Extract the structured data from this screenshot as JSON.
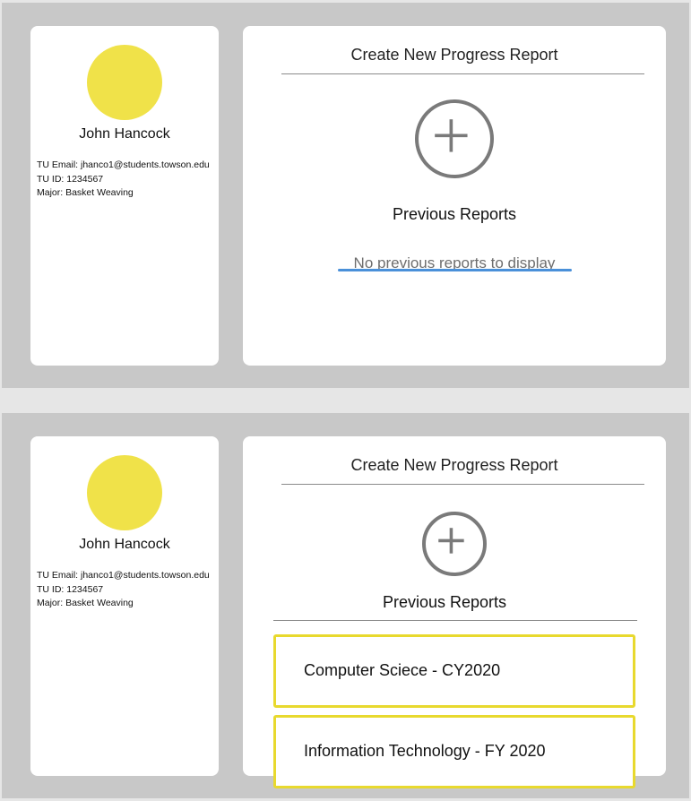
{
  "colors": {
    "avatar": "#f0e249",
    "report_border": "#e8d92e",
    "empty_underline": "#4a90d9",
    "background": "#c8c8c8"
  },
  "screen_empty": {
    "profile": {
      "name": "John Hancock",
      "email": "TU Email: jhanco1@students.towson.edu",
      "tu_id": "TU ID: 1234567",
      "major": "Major: Basket Weaving"
    },
    "main": {
      "create_title": "Create New Progress Report",
      "add_icon": "plus-circle-icon",
      "previous_title": "Previous Reports",
      "empty_message": "No previous reports to display"
    }
  },
  "screen_list": {
    "profile": {
      "name": "John Hancock",
      "email": "TU Email: jhanco1@students.towson.edu",
      "tu_id": "TU ID: 1234567",
      "major": "Major: Basket Weaving"
    },
    "main": {
      "create_title": "Create New Progress Report",
      "add_icon": "plus-circle-icon",
      "previous_title": "Previous Reports",
      "reports": [
        {
          "label": "Computer Sciece - CY2020"
        },
        {
          "label": "Information Technology - FY 2020"
        }
      ]
    }
  }
}
